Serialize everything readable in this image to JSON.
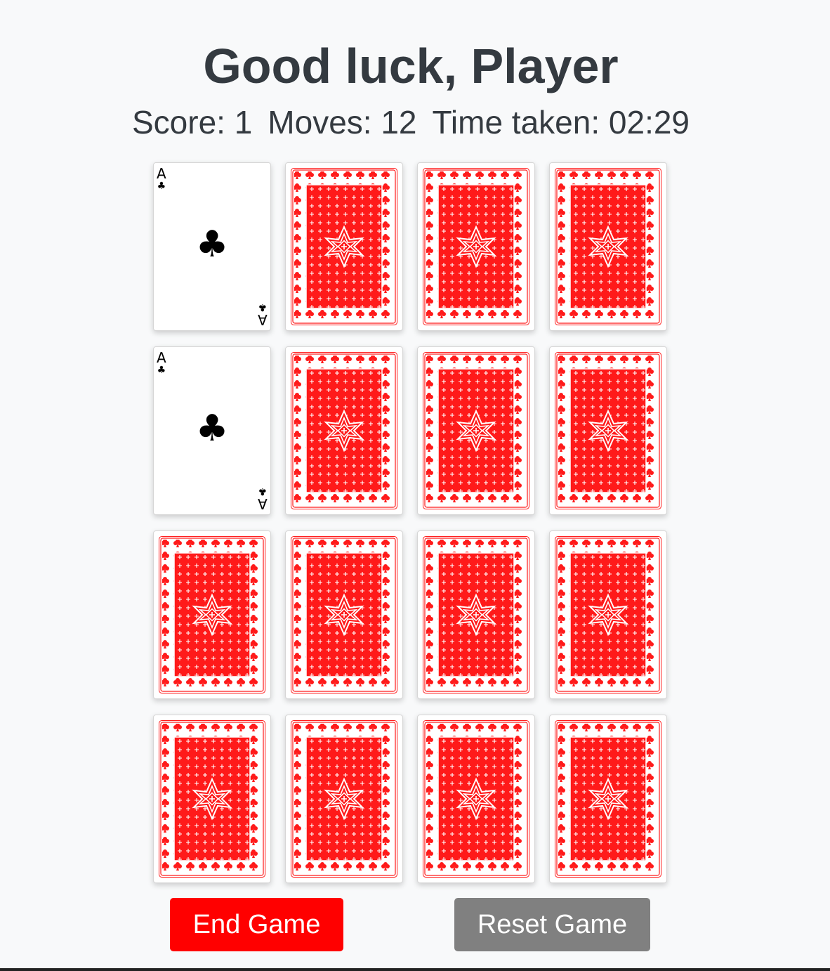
{
  "header": {
    "title": "Good luck, Player"
  },
  "stats": {
    "score": "Score: 1",
    "moves": "Moves: 12",
    "time": "Time taken: 02:29"
  },
  "board": {
    "cards": [
      {
        "state": "face-up",
        "rank": "A",
        "suit": "♣"
      },
      {
        "state": "face-down"
      },
      {
        "state": "face-down"
      },
      {
        "state": "face-down"
      },
      {
        "state": "face-up",
        "rank": "A",
        "suit": "♣"
      },
      {
        "state": "face-down"
      },
      {
        "state": "face-down"
      },
      {
        "state": "face-down"
      },
      {
        "state": "face-down"
      },
      {
        "state": "face-down"
      },
      {
        "state": "face-down"
      },
      {
        "state": "face-down"
      },
      {
        "state": "face-down"
      },
      {
        "state": "face-down"
      },
      {
        "state": "face-down"
      },
      {
        "state": "face-down"
      }
    ],
    "back_icon": "ornate-card-back-pattern",
    "back_color": "#ff0000"
  },
  "buttons": {
    "end_label": "End Game",
    "reset_label": "Reset Game",
    "end_color": "#ff0000",
    "reset_color": "#808080"
  }
}
